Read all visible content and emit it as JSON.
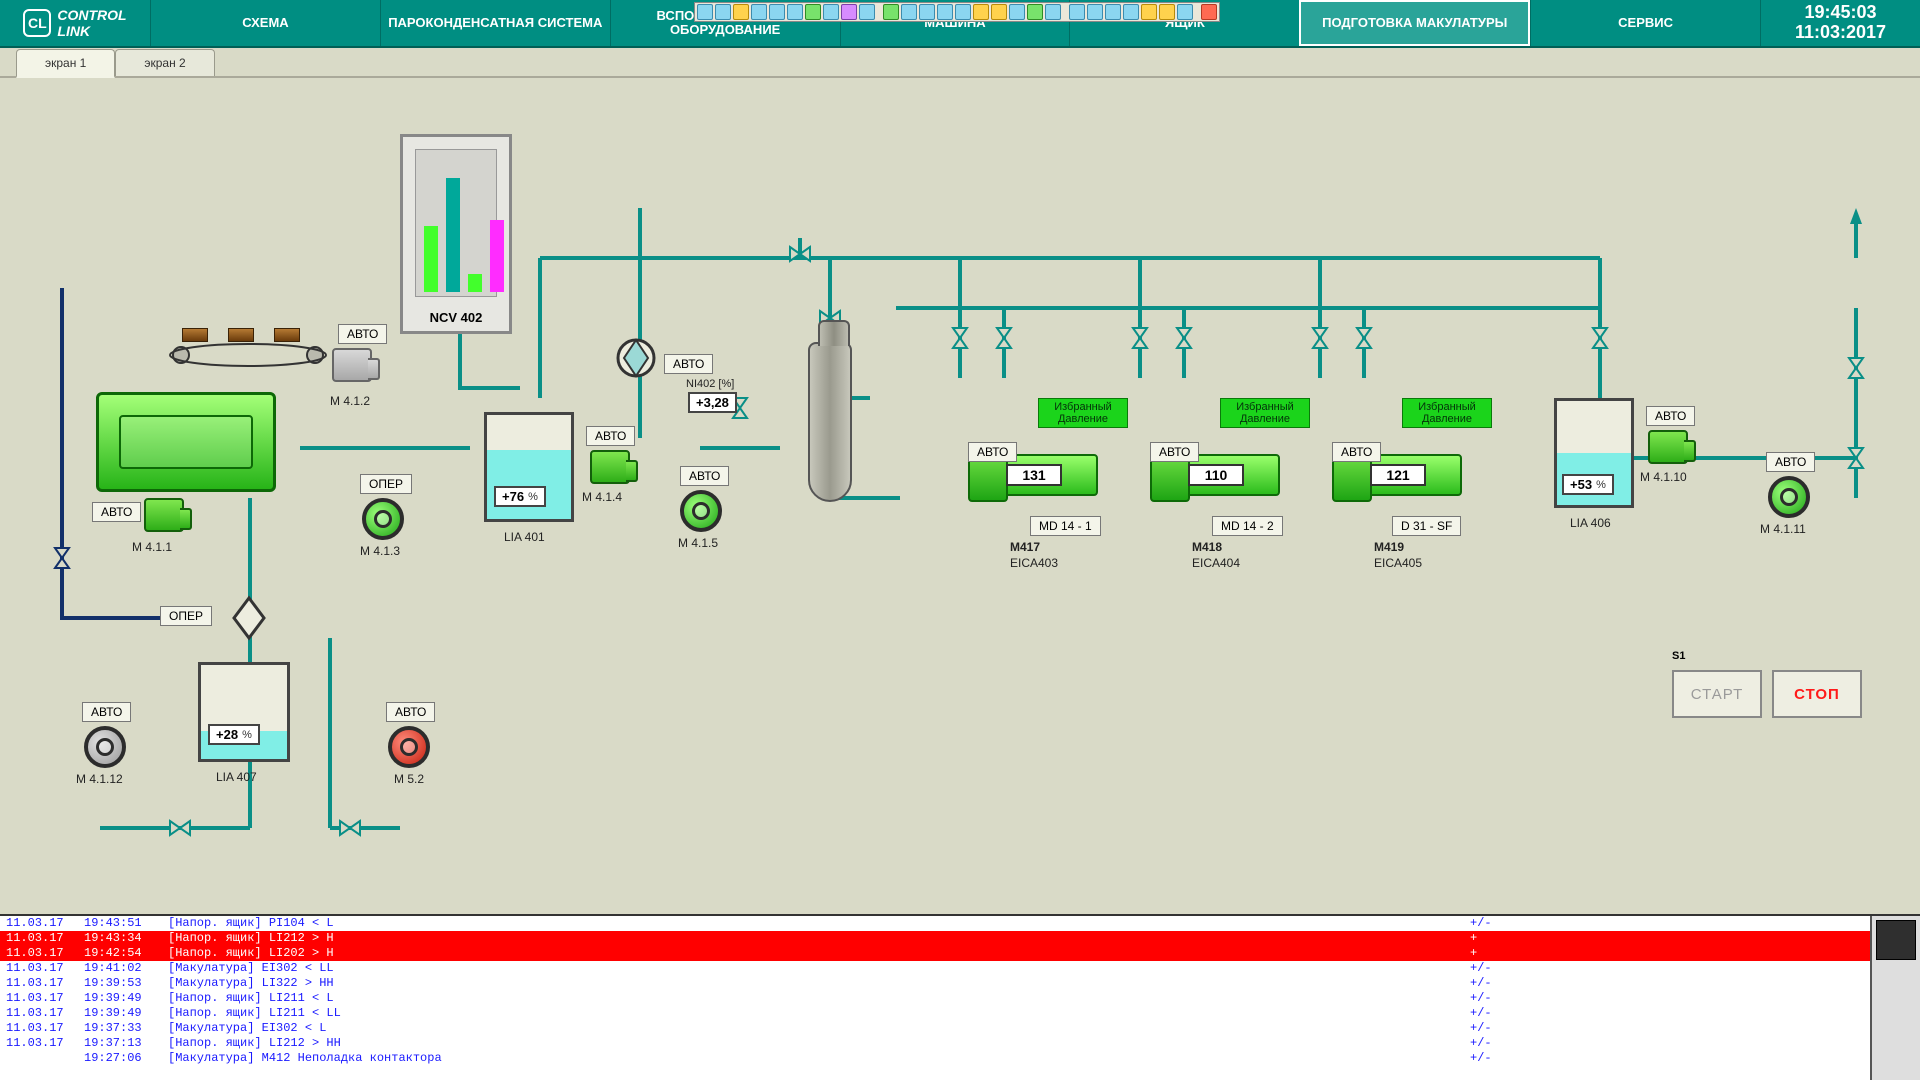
{
  "header": {
    "logo_top": "CONTROL",
    "logo_bottom": "LINK",
    "items": [
      "СХЕМА",
      "ПАРОКОНДЕНСАТНАЯ СИСТЕМА",
      "ВСПОМОГАТЕЛЬНОЕ ОБОРУДОВАНИЕ",
      "МАШИНА",
      "ЯЩИК",
      "ПОДГОТОВКА МАКУЛАТУРЫ",
      "СЕРВИС"
    ],
    "active_index": 5,
    "time": "19:45:03",
    "date": "11:03:2017"
  },
  "tabs": [
    "экран 1",
    "экран 2"
  ],
  "barpanel": {
    "title": "NCV 402"
  },
  "ni402": {
    "label": "NI402 [%]",
    "value": "+3,28"
  },
  "tanks": {
    "lia401": {
      "label": "LIA 401",
      "value": "+76",
      "unit": "%",
      "mode": "АВТО",
      "motor": "M 4.1.4"
    },
    "lia406": {
      "label": "LIA 406",
      "value": "+53",
      "unit": "%",
      "mode": "АВТО",
      "motor": "M 4.1.10"
    },
    "lia407": {
      "label": "LIA 407",
      "value": "+28",
      "unit": "%"
    }
  },
  "motors": {
    "m411": "M 4.1.1",
    "m412": "M 4.1.2",
    "m413": "M 4.1.3",
    "m414": "M 4.1.4",
    "m415": "M 4.1.5",
    "m4110": "M 4.1.10",
    "m4111": "M 4.1.11",
    "m4112": "M 4.1.12",
    "m52": "M 5.2"
  },
  "modes": {
    "auto": "АВТО",
    "oper": "ОПЕР"
  },
  "compressors": [
    {
      "id": "M417",
      "sub": "EICA403",
      "tag": "MD 14 - 1",
      "val": "131",
      "ind1": "Избранный",
      "ind2": "Давление",
      "mode": "АВТО"
    },
    {
      "id": "M418",
      "sub": "EICA404",
      "tag": "MD 14 - 2",
      "val": "110",
      "ind1": "Избранный",
      "ind2": "Давление",
      "mode": "АВТО"
    },
    {
      "id": "M419",
      "sub": "EICA405",
      "tag": "D 31 - SF",
      "val": "121",
      "ind1": "Избранный",
      "ind2": "Давление",
      "mode": "АВТО"
    }
  ],
  "s1": {
    "label": "S1",
    "start": "СТАРТ",
    "stop": "СТОП"
  },
  "alarms": [
    {
      "d": "11.03.17",
      "t": "19:43:51",
      "m": "[Напор. ящик] PI104 < L",
      "f": "+/-",
      "cls": "blue"
    },
    {
      "d": "11.03.17",
      "t": "19:43:34",
      "m": "[Напор. ящик] LI212 > H",
      "f": "+",
      "cls": "red"
    },
    {
      "d": "11.03.17",
      "t": "19:42:54",
      "m": "[Напор. ящик] LI202 > H",
      "f": "+",
      "cls": "red"
    },
    {
      "d": "11.03.17",
      "t": "19:41:02",
      "m": "[Макулатура] EI302 < LL",
      "f": "+/-",
      "cls": "blue"
    },
    {
      "d": "11.03.17",
      "t": "19:39:53",
      "m": "[Макулатура] LI322 > HH",
      "f": "+/-",
      "cls": "blue"
    },
    {
      "d": "11.03.17",
      "t": "19:39:49",
      "m": "[Напор. ящик] LI211 < L",
      "f": "+/-",
      "cls": "blue"
    },
    {
      "d": "11.03.17",
      "t": "19:39:49",
      "m": "[Напор. ящик] LI211 < LL",
      "f": "+/-",
      "cls": "blue"
    },
    {
      "d": "11.03.17",
      "t": "19:37:33",
      "m": "[Макулатура] EI302 < L",
      "f": "+/-",
      "cls": "blue"
    },
    {
      "d": "11.03.17",
      "t": "19:37:13",
      "m": "[Напор. ящик] LI212 > HH",
      "f": "+/-",
      "cls": "blue"
    },
    {
      "d": "",
      "t": "19:27:06",
      "m": "[Макулатура] M412 Неполадка контактора",
      "f": "+/-",
      "cls": "blue"
    }
  ]
}
